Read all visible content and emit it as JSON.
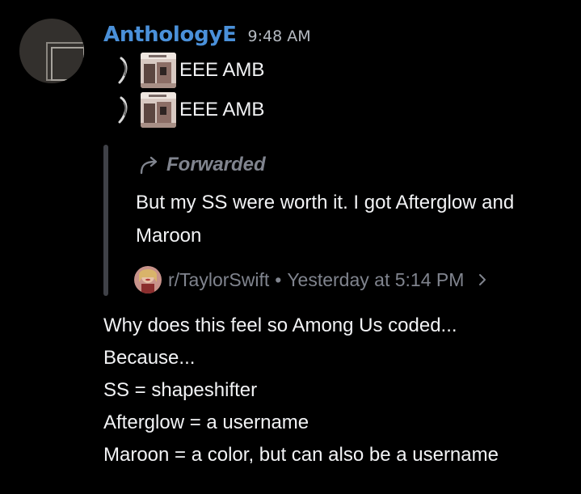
{
  "message": {
    "author": "AnthologyE",
    "timestamp": "9:48 AM",
    "username_color": "#4a90d9",
    "avatar_icon": "overlapping-squares-icon",
    "attachments": [
      {
        "icon": "mini-figure-icon",
        "thumbnail": "album-cover-thumbnail",
        "label": "EEE AMB"
      },
      {
        "icon": "mini-figure-icon",
        "thumbnail": "album-cover-thumbnail",
        "label": "EEE AMB"
      }
    ],
    "forwarded": {
      "label": "Forwarded",
      "icon": "forward-arrow-icon",
      "text": "But my SS were worth it. I got Afterglow and Maroon",
      "source": {
        "icon": "subreddit-avatar-icon",
        "name": "r/TaylorSwift",
        "separator": "•",
        "time": "Yesterday at 5:14 PM",
        "chevron": "chevron-right-icon"
      }
    },
    "lines": [
      "Why does this feel so Among Us coded...",
      "Because...",
      "SS = shapeshifter",
      "Afterglow = a username",
      "Maroon = a color, but can also be a username"
    ]
  }
}
